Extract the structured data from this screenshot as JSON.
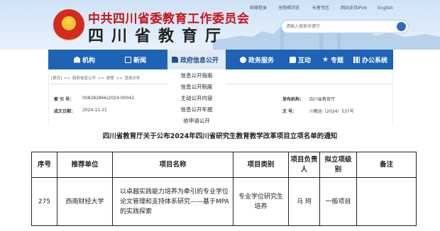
{
  "header": {
    "org_name": "中共四川省委教育工作委员会",
    "dept_name": "四川省教育厅",
    "top_links": [
      "邮箱登录",
      "无障碍浏览",
      "长者专区",
      "网站支持IPv6",
      "English"
    ],
    "search_placeholder": "请输入搜索关键字"
  },
  "nav": {
    "items": [
      {
        "label": "机构",
        "icon": "building-icon"
      },
      {
        "label": "新闻",
        "icon": "news-icon"
      },
      {
        "label": "政府信息公开",
        "icon": "document-icon",
        "active": true
      },
      {
        "label": "政务服务",
        "icon": "service-icon"
      },
      {
        "label": "互动",
        "icon": "chat-icon"
      },
      {
        "label": "专题",
        "icon": "star-icon"
      },
      {
        "label": "办公系统",
        "icon": "grid-icon"
      }
    ],
    "dropdown": [
      "信息公开指南",
      "信息公开制度",
      "主动公开内容",
      "信息公开年报",
      "依申请公开"
    ]
  },
  "breadcrumb": [
    "[首页]",
    "政府信息公开",
    "政策",
    "其他文件"
  ],
  "meta": {
    "index_label": "索 引 号：",
    "index_value": "008282866/2024-00042",
    "date_label": "成文日期：",
    "date_value": "2024-11-21",
    "publisher_label": "发布机构：",
    "publisher_value": "四川省教育厅",
    "docno_label": "文 号：",
    "docno_value": "川教函〔2024〕537号"
  },
  "page_title": "四川省教育厅关于公布2024年四川省研究生教育教学改革项目立项名单的通知",
  "table": {
    "headers": [
      "序号",
      "推荐单位",
      "项目名称",
      "项目类别",
      "项目负责人",
      "拟立项级别",
      "备注"
    ],
    "rows": [
      [
        "275",
        "西南财经大学",
        "以卓越实践能力培养为牵引的专业学位论文管理和支持体系研究——基于MPA的实践探索",
        "专业学位研究生培养",
        "马 珂",
        "一般项目",
        ""
      ]
    ]
  },
  "colors": {
    "nav_bg": "#1e63b5",
    "title_red": "#c8141a",
    "banner_bg": "#d6e7f8"
  }
}
